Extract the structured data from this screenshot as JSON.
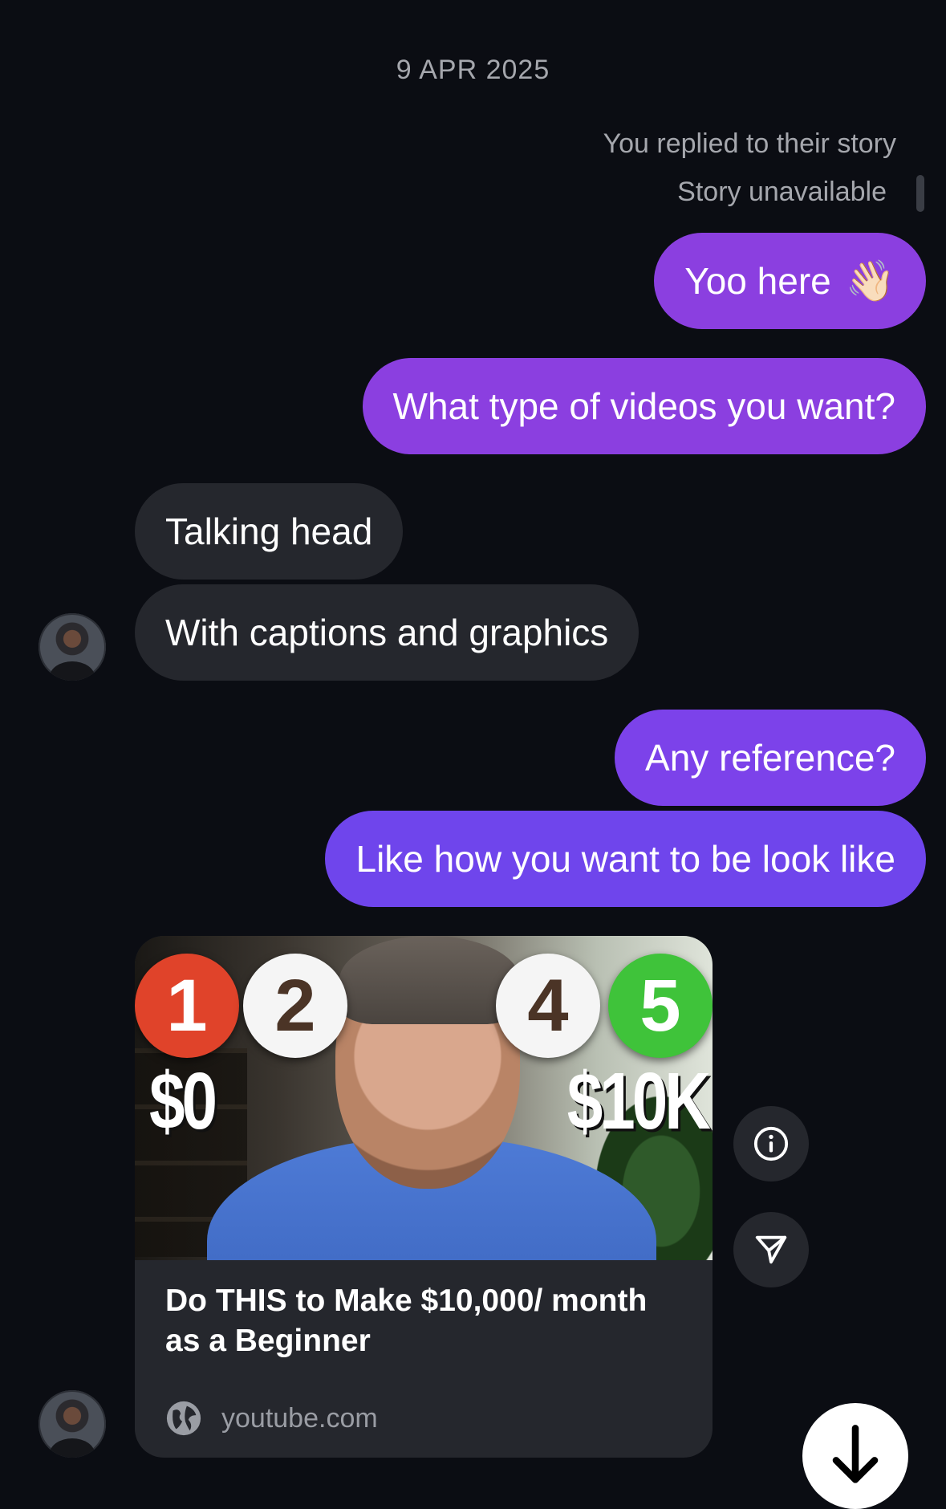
{
  "conversation": {
    "date": "9 APR 2025",
    "story_reply_note": "You replied to their story",
    "story_status": "Story unavailable",
    "messages": [
      {
        "from": "me",
        "text": "Yoo here",
        "emoji": "👋🏻"
      },
      {
        "from": "me",
        "text": "What type of videos you want?"
      },
      {
        "from": "them",
        "text": "Talking head"
      },
      {
        "from": "them",
        "text": "With captions and graphics"
      },
      {
        "from": "me",
        "text": "Any reference?"
      },
      {
        "from": "me",
        "text": "Like how you want to be look like"
      }
    ],
    "link_card": {
      "thumbnail_text": {
        "numbers": [
          "1",
          "2",
          "4",
          "5"
        ],
        "left_amount": "$0",
        "right_amount": "$10K"
      },
      "title": "Do THIS to Make $10,000/ month as a Beginner",
      "domain": "youtube.com"
    }
  },
  "icons": {
    "info": "info-icon",
    "share": "send-icon",
    "scroll_down": "arrow-down-icon",
    "globe": "globe-icon"
  },
  "colors": {
    "background": "#0b0d13",
    "my_bubble": "#8b3fe0",
    "their_bubble": "#25272d"
  }
}
